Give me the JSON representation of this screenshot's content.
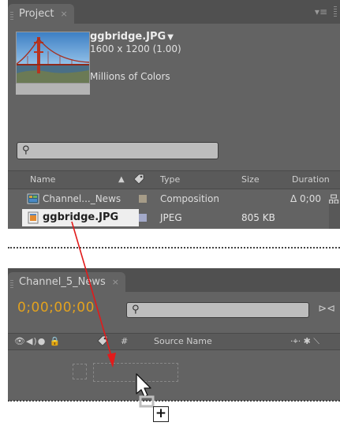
{
  "project_panel": {
    "tab_label": "Project",
    "tab_close": "×",
    "menu_icon": "▾≡",
    "footage": {
      "name": "ggbridge.JPG",
      "caret": "▼",
      "dimensions": "1600 x 1200 (1.00)",
      "color_depth": "Millions of Colors"
    },
    "search": {
      "icon": "⚲",
      "value": ""
    },
    "columns": {
      "name": "Name",
      "sort": "▲",
      "label_icon": "tag-icon",
      "type": "Type",
      "size": "Size",
      "duration": "Duration"
    },
    "items": [
      {
        "name": "Channel..._News",
        "type": "Composition",
        "size": "",
        "duration": "Δ 0;00",
        "label_color": "#a69c88"
      },
      {
        "name": "ggbridge.JPG",
        "type": "JPEG",
        "size": "805 KB",
        "duration": "",
        "label_color": "#a3a9c9"
      }
    ]
  },
  "comp_panel": {
    "tab_label": "Channel_5_News",
    "tab_close": "×",
    "timecode": "0;00;00;00",
    "search": {
      "icon": "⚲",
      "value": ""
    },
    "layer_columns": {
      "switches": "👁◀)● 🔒",
      "label_icon": "tag-icon",
      "number": "#",
      "source_name": "Source Name",
      "right_icons": "·⌖· ✱ ⟍"
    }
  },
  "drag_overlay": {
    "arrow_color": "#e11b1b",
    "plus_label": "+"
  }
}
